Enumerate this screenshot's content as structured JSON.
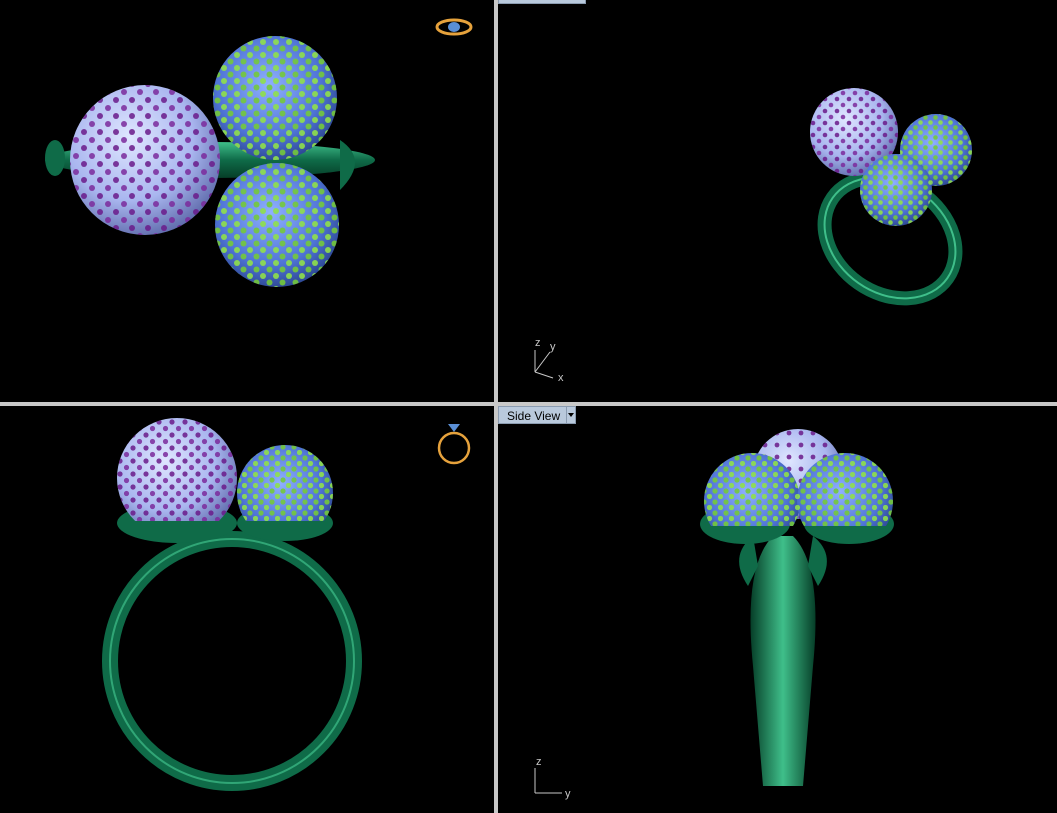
{
  "viewports": {
    "top_left": {
      "name": "",
      "gizmo_icon": "ring-top-icon"
    },
    "top_right": {
      "name": "",
      "axes": {
        "z": "z",
        "y": "y",
        "x": "x"
      }
    },
    "bottom_left": {
      "name": "",
      "gizmo_icon": "ring-front-icon"
    },
    "bottom_right": {
      "name": "Side View",
      "axes": {
        "z": "z",
        "y": "y"
      }
    }
  },
  "colors": {
    "background": "#000000",
    "band": "#0f6b48",
    "band_highlight": "#3fbf8a",
    "sphere_large": "#a9b6ef",
    "sphere_small": "#4f74d6",
    "stones_purple": "#6a1a8a",
    "stones_green": "#8fe04a",
    "gizmo": "#e6a23c"
  }
}
